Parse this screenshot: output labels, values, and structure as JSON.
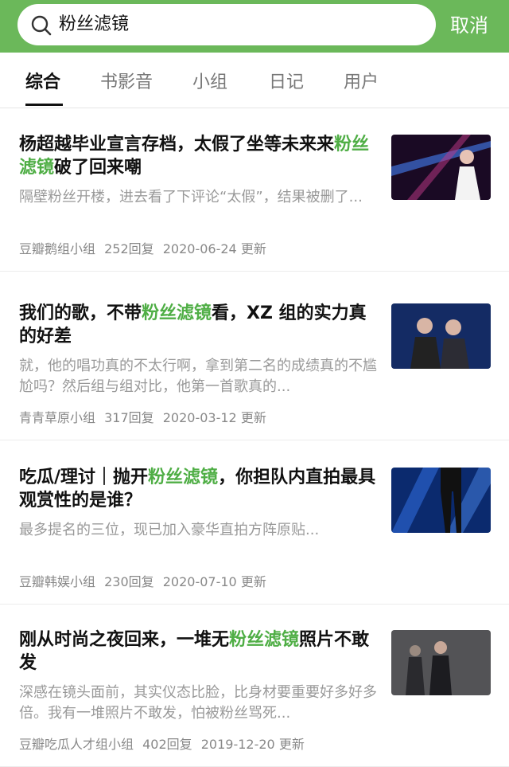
{
  "search": {
    "query": "粉丝滤镜",
    "cancel_label": "取消",
    "search_icon": "search-icon"
  },
  "tabs": [
    {
      "label": "综合",
      "active": true
    },
    {
      "label": "书影音",
      "active": false
    },
    {
      "label": "小组",
      "active": false
    },
    {
      "label": "日记",
      "active": false
    },
    {
      "label": "用户",
      "active": false
    }
  ],
  "colors": {
    "brand_green": "#6bb85a",
    "highlight_green": "#4fae45"
  },
  "results": [
    {
      "title_pre": "杨超越毕业宣言存档，太假了坐等未来来",
      "title_hl": "粉丝滤镜",
      "title_post": "破了回来嘲",
      "excerpt": "隔壁粉丝开楼，进去看了下评论“太假”，结果被删了...",
      "group": "豆瓣鹅组小组",
      "replies": "252回复",
      "updated": "2020-06-24 更新"
    },
    {
      "title_pre": "我们的歌，不带",
      "title_hl": "粉丝滤镜",
      "title_post": "看，XZ 组的实力真的好差",
      "excerpt": "就，他的唱功真的不太行啊，拿到第二名的成绩真的不尴尬吗？然后组与组对比，他第一首歌真的...",
      "group": "青青草原小组",
      "replies": "317回复",
      "updated": "2020-03-12 更新"
    },
    {
      "title_pre": "吃瓜/理讨｜抛开",
      "title_hl": "粉丝滤镜",
      "title_post": "，你担队内直拍最具观赏性的是谁？",
      "excerpt": "最多提名的三位，现已加入豪华直拍方阵原贴...",
      "group": "豆瓣韩娱小组",
      "replies": "230回复",
      "updated": "2020-07-10 更新"
    },
    {
      "title_pre": "刚从时尚之夜回来，一堆无",
      "title_hl": "粉丝滤镜",
      "title_post": "照片不敢发",
      "excerpt": "深感在镜头面前，其实仪态比脸，比身材要重要好多好多倍。我有一堆照片不敢发，怕被粉丝骂死...",
      "group": "豆瓣吃瓜人才组小组",
      "replies": "402回复",
      "updated": "2019-12-20 更新"
    }
  ]
}
